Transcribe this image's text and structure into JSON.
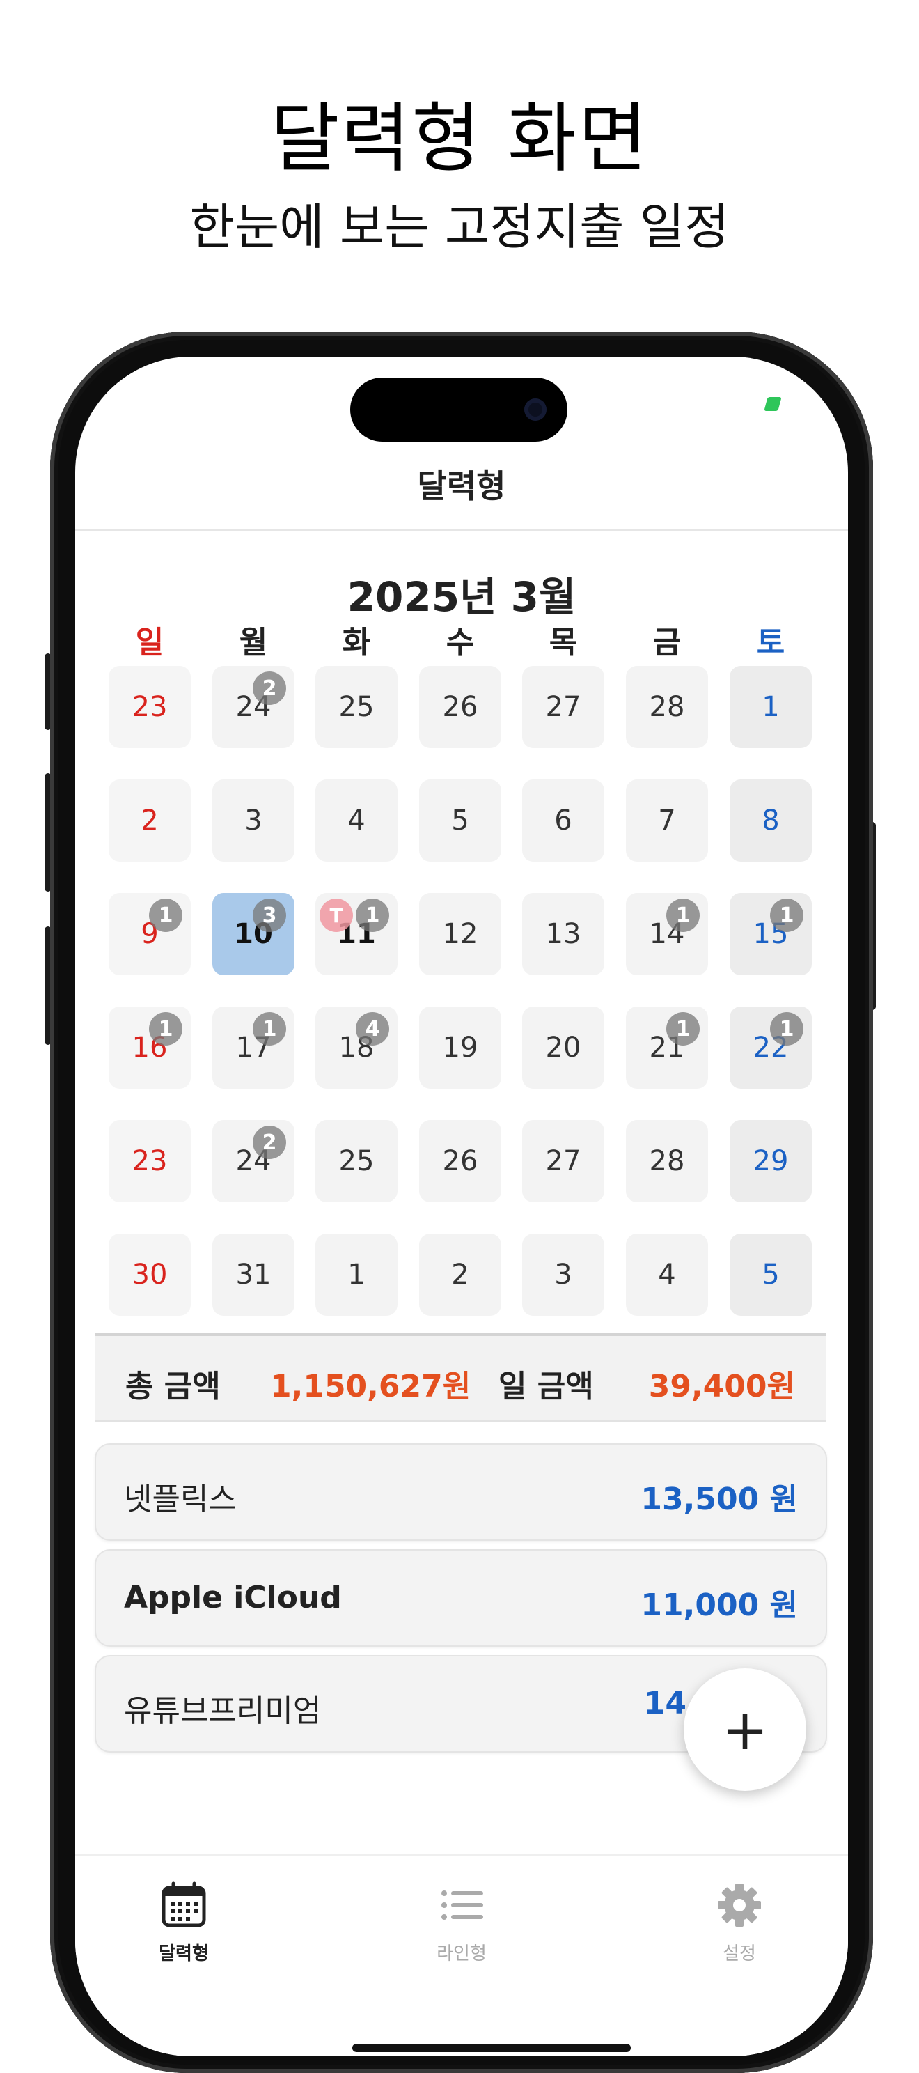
{
  "promo": {
    "headline": "달력형 화면",
    "subheadline": "한눈에 보는 고정지출 일정"
  },
  "nav": {
    "title": "달력형"
  },
  "calendar": {
    "month_title": "2025년 3월",
    "weekdays": [
      "일",
      "월",
      "화",
      "수",
      "목",
      "금",
      "토"
    ],
    "weekday_colors": {
      "sun": "#d9231d",
      "sat": "#1b61c4",
      "default": "#222222"
    },
    "weeks": [
      [
        {
          "d": "23",
          "muted": true
        },
        {
          "d": "24",
          "badge": "2",
          "muted": true
        },
        {
          "d": "25",
          "muted": true
        },
        {
          "d": "26",
          "muted": true
        },
        {
          "d": "27",
          "muted": true
        },
        {
          "d": "28",
          "muted": true
        },
        {
          "d": "1"
        }
      ],
      [
        {
          "d": "2"
        },
        {
          "d": "3"
        },
        {
          "d": "4"
        },
        {
          "d": "5"
        },
        {
          "d": "6"
        },
        {
          "d": "7"
        },
        {
          "d": "8"
        }
      ],
      [
        {
          "d": "9",
          "badge": "1"
        },
        {
          "d": "10",
          "badge": "3",
          "today": true
        },
        {
          "d": "11",
          "badge": "1",
          "tbadge": "T",
          "bold": true
        },
        {
          "d": "12"
        },
        {
          "d": "13"
        },
        {
          "d": "14",
          "badge": "1"
        },
        {
          "d": "15",
          "badge": "1"
        }
      ],
      [
        {
          "d": "16",
          "badge": "1"
        },
        {
          "d": "17",
          "badge": "1"
        },
        {
          "d": "18",
          "badge": "4"
        },
        {
          "d": "19"
        },
        {
          "d": "20"
        },
        {
          "d": "21",
          "badge": "1"
        },
        {
          "d": "22",
          "badge": "1"
        }
      ],
      [
        {
          "d": "23"
        },
        {
          "d": "24",
          "badge": "2"
        },
        {
          "d": "25"
        },
        {
          "d": "26"
        },
        {
          "d": "27"
        },
        {
          "d": "28"
        },
        {
          "d": "29"
        }
      ],
      [
        {
          "d": "30"
        },
        {
          "d": "31"
        },
        {
          "d": "1",
          "muted": true
        },
        {
          "d": "2",
          "muted": true
        },
        {
          "d": "3",
          "muted": true
        },
        {
          "d": "4",
          "muted": true
        },
        {
          "d": "5",
          "muted": true
        }
      ]
    ]
  },
  "summary": {
    "total_label": "총 금액",
    "total_amount": "1,150,627원",
    "daily_label": "일 금액",
    "daily_amount": "39,400원",
    "amount_color": "#e4501f"
  },
  "items": [
    {
      "name": "넷플릭스",
      "price": "13,500 원"
    },
    {
      "name": "Apple iCloud",
      "price": "11,000 원"
    },
    {
      "name": "유튜브프리미엄",
      "price": "14"
    }
  ],
  "fab": {
    "icon": "plus-icon",
    "glyph": "+"
  },
  "tabs": [
    {
      "label": "달력형",
      "icon": "calendar-icon",
      "active": true
    },
    {
      "label": "라인형",
      "icon": "list-icon",
      "active": false
    },
    {
      "label": "설정",
      "icon": "gear-icon",
      "active": false
    }
  ]
}
